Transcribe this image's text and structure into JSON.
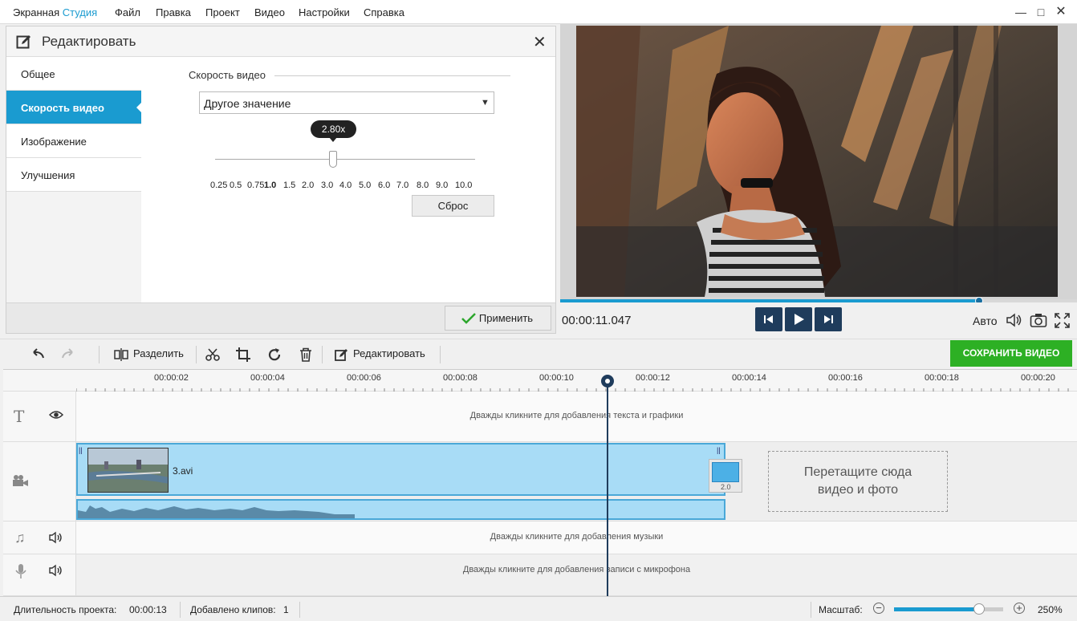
{
  "app": {
    "title_part1": "Экранная",
    "title_part2": "Студия"
  },
  "menu": [
    "Файл",
    "Правка",
    "Проект",
    "Видео",
    "Настройки",
    "Справка"
  ],
  "editor": {
    "title": "Редактировать",
    "sidebar": [
      {
        "label": "Общее",
        "active": false
      },
      {
        "label": "Скорость видео",
        "active": true
      },
      {
        "label": "Изображение",
        "active": false
      },
      {
        "label": "Улучшения",
        "active": false
      }
    ],
    "speed": {
      "section_label": "Скорость видео",
      "select_value": "Другое значение",
      "tooltip": "2.80x",
      "slider_fraction": 0.454,
      "scale": [
        "0.25",
        "0.5",
        "0.75",
        "1.0",
        "1.5",
        "2.0",
        "3.0",
        "4.0",
        "5.0",
        "6.0",
        "7.0",
        "8.0",
        "9.0",
        "10.0"
      ],
      "bold_scale": "1.0",
      "reset_label": "Сброс"
    },
    "apply_label": "Применить"
  },
  "player": {
    "timecode": "00:00:11.047",
    "progress_fraction": 0.81,
    "auto_label": "Авто"
  },
  "toolbar": {
    "split_label": "Разделить",
    "edit_label": "Редактировать",
    "save_label": "СОХРАНИТЬ ВИДЕО",
    "save_color": "#2db024"
  },
  "timeline": {
    "ticks": [
      "00:00:02",
      "00:00:04",
      "00:00:06",
      "00:00:08",
      "00:00:10",
      "00:00:12",
      "00:00:14",
      "00:00:16",
      "00:00:18",
      "00:00:20"
    ],
    "text_hint": "Дважды кликните для добавления текста и графики",
    "clip_name": "3.avi",
    "transition_label": "2.0",
    "drop_hint_1": "Перетащите сюда",
    "drop_hint_2": "видео и фото",
    "music_hint": "Дважды кликните для добавления музыки",
    "mic_hint": "Дважды кликните для добавления записи с микрофона"
  },
  "status": {
    "duration_label": "Длительность проекта:",
    "duration_value": "00:00:13",
    "clips_label": "Добавлено клипов:",
    "clips_value": "1",
    "zoom_label": "Масштаб:",
    "zoom_value": "250%",
    "zoom_fraction": 0.78
  }
}
